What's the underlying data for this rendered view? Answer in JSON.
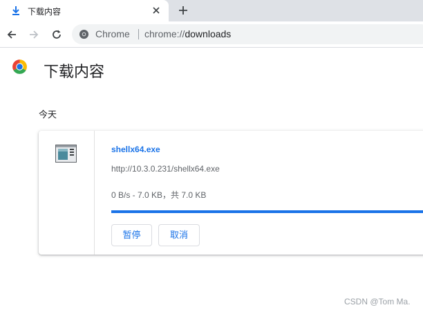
{
  "tab": {
    "title": "下载内容",
    "icon": "download-icon",
    "close_icon": "close-icon"
  },
  "toolbar": {
    "back_icon": "back-arrow-icon",
    "forward_icon": "forward-arrow-icon",
    "reload_icon": "reload-icon",
    "omnibox": {
      "chip": "Chrome",
      "url_scheme": "chrome://",
      "url_path": "downloads"
    }
  },
  "page": {
    "title": "下载内容",
    "logo": "chrome-logo-icon"
  },
  "downloads": {
    "date_label": "今天",
    "item": {
      "file_name": "shellx64.exe",
      "url": "http://10.3.0.231/shellx64.exe",
      "status": "0 B/s - 7.0 KB，共 7.0 KB",
      "progress_fraction": 1.0,
      "pause_label": "暂停",
      "cancel_label": "取消"
    }
  },
  "watermark": "CSDN @Tom Ma.",
  "colors": {
    "accent": "#1a73e8",
    "tabstrip": "#dee1e6",
    "omnibox": "#f1f3f4"
  }
}
